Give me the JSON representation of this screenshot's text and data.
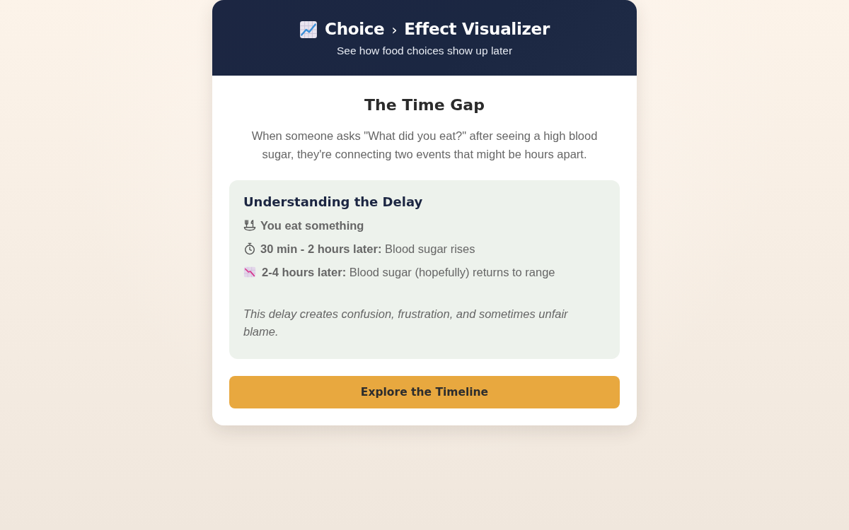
{
  "header": {
    "title_from": "Choice",
    "separator": "›",
    "title_to": "Effect Visualizer",
    "subtitle": "See how food choices show up later"
  },
  "intro": {
    "title": "The Time Gap",
    "text": "When someone asks \"What did you eat?\" after seeing a high blood sugar, they're connecting two events that might be hours apart."
  },
  "delay_panel": {
    "title": "Understanding the Delay",
    "steps": [
      {
        "kind": "meal",
        "label": "You eat something"
      },
      {
        "kind": "stopwatch",
        "label": "30 min - 2 hours later:",
        "detail": "Blood sugar rises"
      },
      {
        "kind": "chart-down",
        "label": "2-4 hours later:",
        "detail": "Blood sugar (hopefully) returns to range"
      }
    ],
    "note": "This delay creates confusion, frustration, and sometimes unfair blame."
  },
  "buttons": [
    {
      "label": "Explore the Timeline"
    }
  ]
}
